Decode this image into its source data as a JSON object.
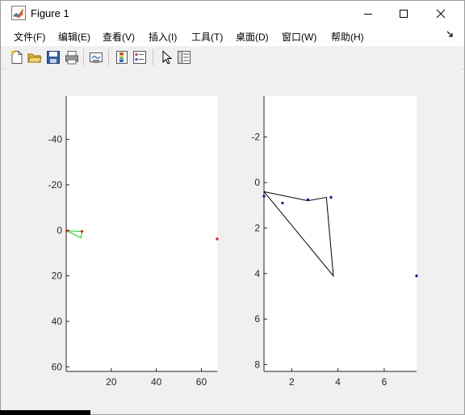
{
  "window": {
    "title": "Figure 1",
    "icon": "matlab-icon",
    "controls": [
      "minimize-icon",
      "maximize-icon",
      "close-icon"
    ]
  },
  "menu": {
    "items": [
      "文件(F)",
      "编辑(E)",
      "查看(V)",
      "插入(I)",
      "工具(T)",
      "桌面(D)",
      "窗口(W)",
      "帮助(H)"
    ],
    "overflow_icon": "dock-arrow-icon"
  },
  "toolbar": {
    "buttons": [
      "new-figure-icon",
      "open-file-icon",
      "save-icon",
      "print-icon",
      "link-plot-icon",
      "insert-colorbar-icon",
      "insert-legend-icon",
      "edit-plot-icon",
      "property-inspector-icon"
    ]
  },
  "colors": {
    "axes_bg": "#ffffff",
    "figure_bg": "#f0f0f0",
    "left_points": "#ff0000",
    "left_polygon": "#00dd00",
    "right_points": "#0000cc",
    "right_polygon": "#000000"
  },
  "chart_data": [
    {
      "type": "scatter",
      "title": "",
      "xlabel": "",
      "ylabel": "",
      "xlim": [
        0,
        67
      ],
      "ylim": [
        -59,
        62
      ],
      "y_reversed": true,
      "xticks": [
        20,
        40,
        60
      ],
      "yticks": [
        -40,
        -20,
        0,
        20,
        40,
        60
      ],
      "xtick_labels": [
        "20",
        "40",
        "60"
      ],
      "ytick_labels": [
        "-40",
        "-20",
        "0",
        "20",
        "40",
        "60"
      ],
      "grid": false,
      "series": [
        {
          "kind": "points",
          "color": "#ff0000",
          "x": [
            0.3,
            7,
            67
          ],
          "y": [
            0.2,
            0.5,
            3.8
          ]
        },
        {
          "kind": "polygon",
          "color": "#00dd00",
          "x": [
            0.3,
            7,
            6.5,
            0.3
          ],
          "y": [
            0.2,
            0.5,
            3.3,
            0.2
          ]
        }
      ]
    },
    {
      "type": "scatter",
      "title": "",
      "xlabel": "",
      "ylabel": "",
      "xlim": [
        0.8,
        7.4
      ],
      "ylim": [
        -3.8,
        8.3
      ],
      "y_reversed": true,
      "xticks": [
        2,
        4,
        6
      ],
      "yticks": [
        -2,
        0,
        2,
        4,
        6,
        8
      ],
      "xtick_labels": [
        "2",
        "4",
        "6"
      ],
      "ytick_labels": [
        "-2",
        "0",
        "2",
        "4",
        "6",
        "8"
      ],
      "grid": false,
      "series": [
        {
          "kind": "points",
          "color": "#0000cc",
          "x": [
            0.8,
            1.6,
            2.7,
            3.7,
            7.4
          ],
          "y": [
            0.6,
            0.9,
            0.75,
            0.65,
            4.1
          ]
        },
        {
          "kind": "polygon",
          "color": "#000000",
          "x": [
            0.8,
            2.7,
            3.5,
            3.8,
            0.8
          ],
          "y": [
            0.4,
            0.8,
            0.65,
            4.1,
            0.4
          ]
        }
      ]
    }
  ]
}
